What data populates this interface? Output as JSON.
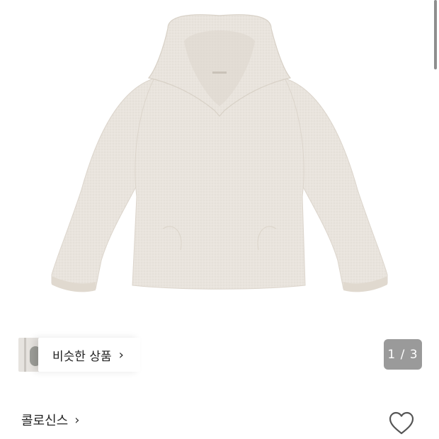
{
  "gallery": {
    "image_label": "beige waffle-knit hoodie product photo",
    "page_current": 1,
    "page_total": 3,
    "pager_text": "1 / 3",
    "background": "#ffffff",
    "product_color": "#e9e4dd"
  },
  "similar": {
    "label": "비슷한 상품",
    "chevron": "chevron-right-icon"
  },
  "brand": {
    "name": "콜로신스",
    "chevron": "chevron-right-icon"
  },
  "like": {
    "icon": "heart-outline-icon",
    "color": "#555555"
  }
}
